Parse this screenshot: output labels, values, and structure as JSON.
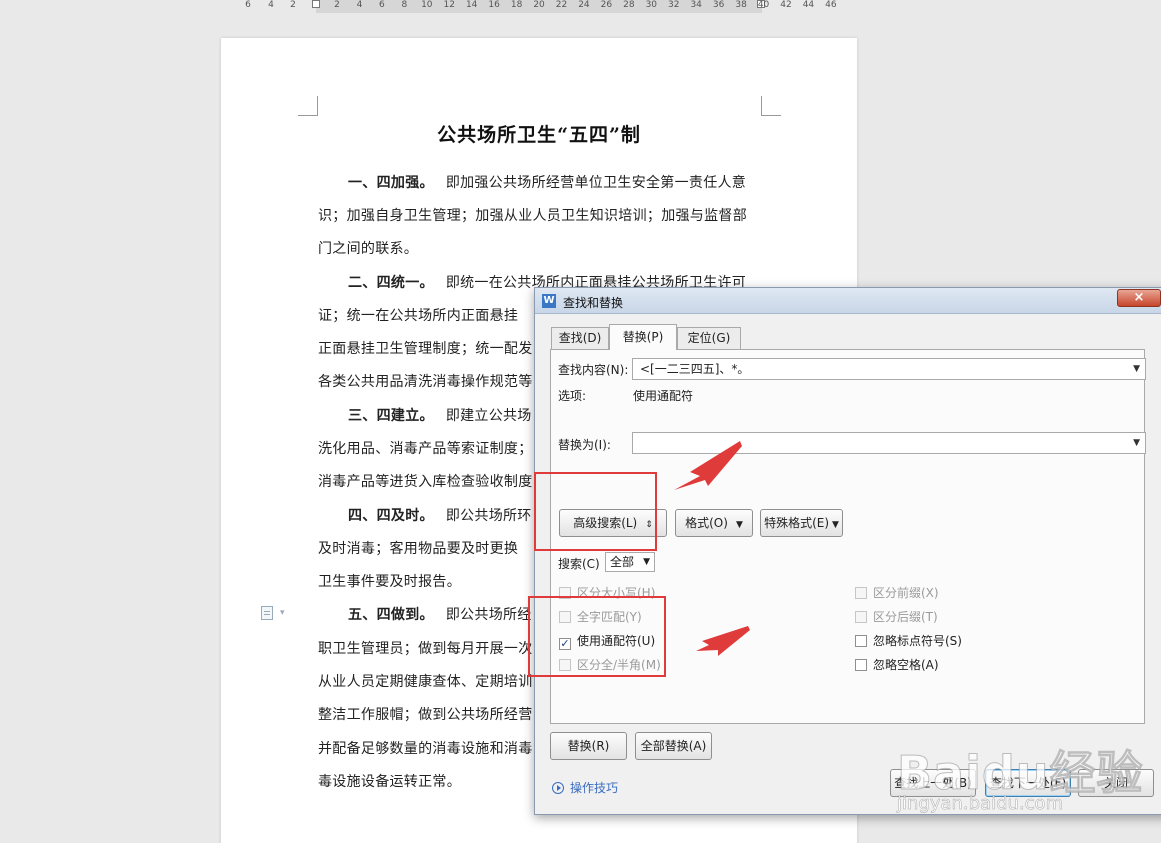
{
  "ruler": {
    "ticks_left": [
      "6",
      "4",
      "2"
    ],
    "ticks_right": [
      "2",
      "4",
      "6",
      "8",
      "10",
      "12",
      "14",
      "16",
      "18",
      "20",
      "22",
      "24",
      "26",
      "28",
      "30",
      "32",
      "34",
      "36",
      "38",
      "40",
      "42",
      "44",
      "46"
    ]
  },
  "document": {
    "title": "公共场所卫生“五四”制",
    "paragraphs": [
      {
        "lead": "一、四加强。",
        "lines": [
          "即加强公共场所经营单位卫生安全第一责任人意",
          "识；加强自身卫生管理；加强从业人员卫生知识培训；加强与监督部",
          "门之间的联系。"
        ]
      },
      {
        "lead": "二、四统一。",
        "lines": [
          "即统一在公共场所内正面悬挂公共场所卫生许可",
          "证；统一在公共场所内正面悬挂",
          "正面悬挂卫生管理制度；统一配发",
          "各类公共用品清洗消毒操作规范等"
        ]
      },
      {
        "lead": "三、四建立。",
        "lines": [
          "即建立公共场",
          "洗化用品、消毒产品等索证制度；",
          "消毒产品等进货入库检查验收制度"
        ]
      },
      {
        "lead": "四、四及时。",
        "lines": [
          "即公共场所环",
          "及时消毒；客用物品要及时更换",
          "卫生事件要及时报告。"
        ]
      },
      {
        "lead": "五、四做到。",
        "lines": [
          "即公共场所经",
          "职卫生管理员；做到每月开展一次",
          "从业人员定期健康查体、定期培训",
          "整洁工作服帽；做到公共场所经营",
          "并配备足够数量的消毒设施和消毒",
          "毒设施设备运转正常。"
        ]
      }
    ]
  },
  "dialog": {
    "title": "查找和替换",
    "close": "×",
    "tabs": [
      "查找(D)",
      "替换(P)",
      "定位(G)"
    ],
    "find_label": "查找内容(N):",
    "find_value": "<[一二三四五]、*。",
    "options_label": "选项:",
    "options_value": "使用通配符",
    "replace_label": "替换为(I):",
    "replace_value": "",
    "advanced_btn": "高级搜索(L)",
    "advanced_arrow": "⇕",
    "format_btn": "格式(O)",
    "special_btn": "特殊格式(E)",
    "search_label": "搜索(C)",
    "search_value": "全部",
    "options_left": [
      {
        "label": "区分大小写(H)",
        "checked": false,
        "enabled": false
      },
      {
        "label": "全字匹配(Y)",
        "checked": false,
        "enabled": false
      },
      {
        "label": "使用通配符(U)",
        "checked": true,
        "enabled": true
      },
      {
        "label": "区分全/半角(M)",
        "checked": false,
        "enabled": false
      }
    ],
    "options_right": [
      {
        "label": "区分前缀(X)",
        "checked": false,
        "enabled": false
      },
      {
        "label": "区分后缀(T)",
        "checked": false,
        "enabled": false
      },
      {
        "label": "忽略标点符号(S)",
        "checked": false,
        "enabled": true
      },
      {
        "label": "忽略空格(A)",
        "checked": false,
        "enabled": true
      }
    ],
    "replace_btn": "替换(R)",
    "replace_all_btn": "全部替换(A)",
    "tips": "操作技巧",
    "find_prev_btn": "查找上一处(B)",
    "find_next_btn": "查找下一处(F)",
    "close_btn": "关闭"
  },
  "watermark": {
    "brand": "Baidu经验",
    "url": "jingyan.baidu.com"
  },
  "colors": {
    "annotation": "#e03b3b",
    "link": "#3a6cc0",
    "accent": "#3a78c6"
  }
}
